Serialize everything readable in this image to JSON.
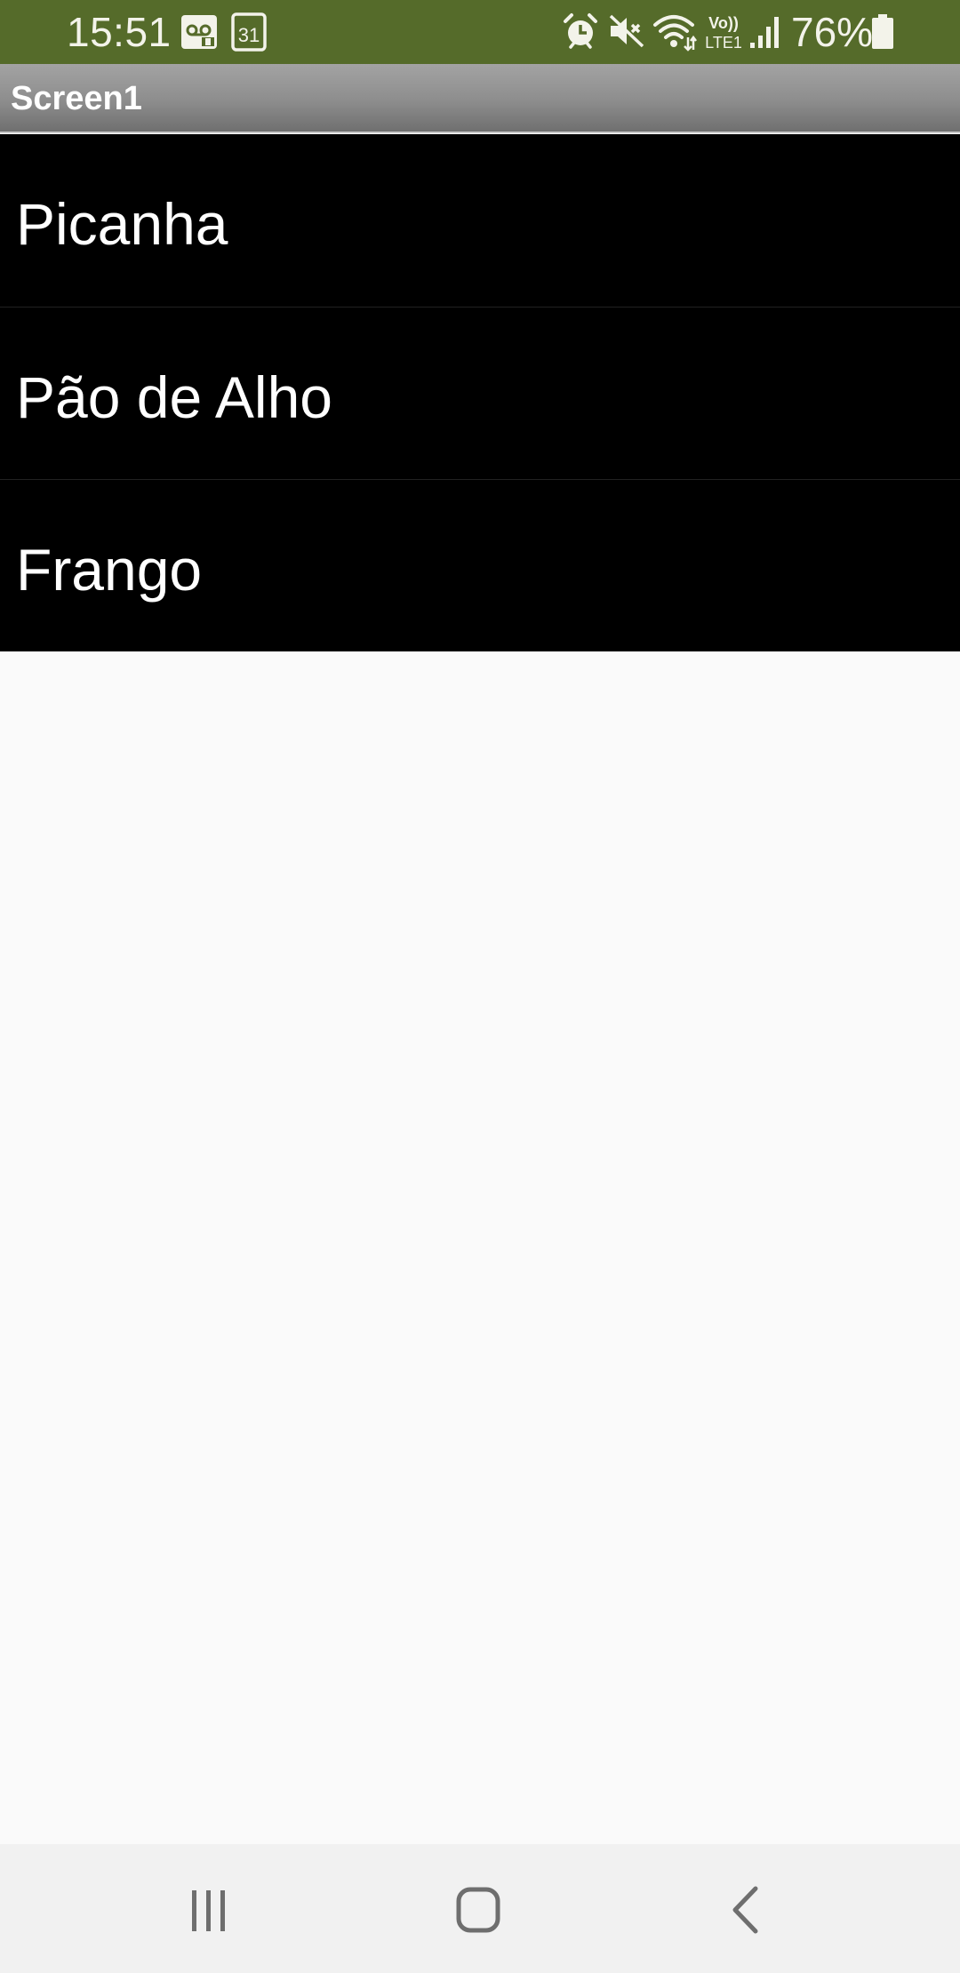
{
  "status_bar": {
    "time": "15:51",
    "calendar_day": "31",
    "battery_percent": "76%",
    "network_label_top": "Vo))",
    "network_label_bottom": "LTE1",
    "icons": [
      "voicemail-icon",
      "calendar-icon",
      "alarm-icon",
      "mute-icon",
      "wifi-icon",
      "volte-icon",
      "signal-icon",
      "battery-icon"
    ],
    "background_color": "#556b2a"
  },
  "title_bar": {
    "title": "Screen1"
  },
  "list": {
    "items": [
      {
        "label": "Picanha"
      },
      {
        "label": "Pão de Alho"
      },
      {
        "label": "Frango"
      }
    ],
    "background_color": "#000000",
    "text_color": "#ffffff"
  },
  "nav_bar": {
    "buttons": [
      "recent-apps",
      "home",
      "back"
    ]
  }
}
